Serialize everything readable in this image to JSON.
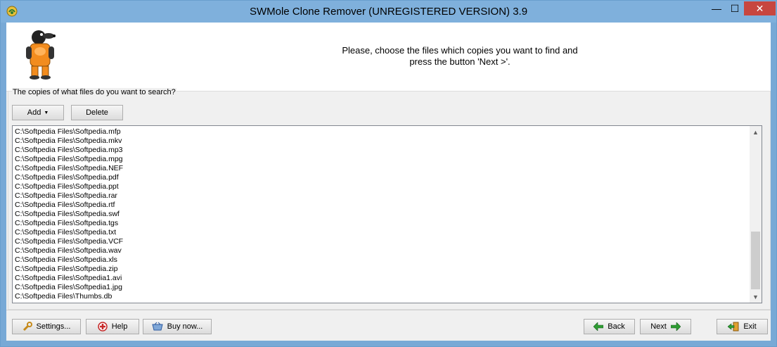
{
  "window": {
    "title": "SWMole Clone Remover (UNREGISTERED VERSION) 3.9",
    "controls": {
      "minimize": "—",
      "maximize": "☐",
      "close": "✕"
    }
  },
  "header": {
    "instructions_line1": "Please, choose the files which copies you want to find and",
    "instructions_line2": "press the button 'Next >'."
  },
  "files_group": {
    "label": "The copies of what files do you want to search?",
    "add_label": "Add",
    "delete_label": "Delete",
    "items": [
      "C:\\Softpedia Files\\Softpedia.mfp",
      "C:\\Softpedia Files\\Softpedia.mkv",
      "C:\\Softpedia Files\\Softpedia.mp3",
      "C:\\Softpedia Files\\Softpedia.mpg",
      "C:\\Softpedia Files\\Softpedia.NEF",
      "C:\\Softpedia Files\\Softpedia.pdf",
      "C:\\Softpedia Files\\Softpedia.ppt",
      "C:\\Softpedia Files\\Softpedia.rar",
      "C:\\Softpedia Files\\Softpedia.rtf",
      "C:\\Softpedia Files\\Softpedia.swf",
      "C:\\Softpedia Files\\Softpedia.tgs",
      "C:\\Softpedia Files\\Softpedia.txt",
      "C:\\Softpedia Files\\Softpedia.VCF",
      "C:\\Softpedia Files\\Softpedia.wav",
      "C:\\Softpedia Files\\Softpedia.xls",
      "C:\\Softpedia Files\\Softpedia.zip",
      "C:\\Softpedia Files\\Softpedia1.avi",
      "C:\\Softpedia Files\\Softpedia1.jpg",
      "C:\\Softpedia Files\\Thumbs.db"
    ]
  },
  "footer": {
    "settings_label": "Settings...",
    "help_label": "Help",
    "buy_label": "Buy now...",
    "back_label": "Back",
    "next_label": "Next",
    "exit_label": "Exit"
  },
  "icons": {
    "app": "swmole-app-icon",
    "mole": "mole-mascot",
    "settings": "wrench-icon",
    "help": "help-icon",
    "buy": "basket-icon",
    "back": "arrow-left-icon",
    "next": "arrow-right-icon",
    "exit": "exit-door-icon"
  },
  "colors": {
    "titlebar": "#7fb0dc",
    "close_button": "#c7463f",
    "arrow_green": "#2e9d32"
  }
}
